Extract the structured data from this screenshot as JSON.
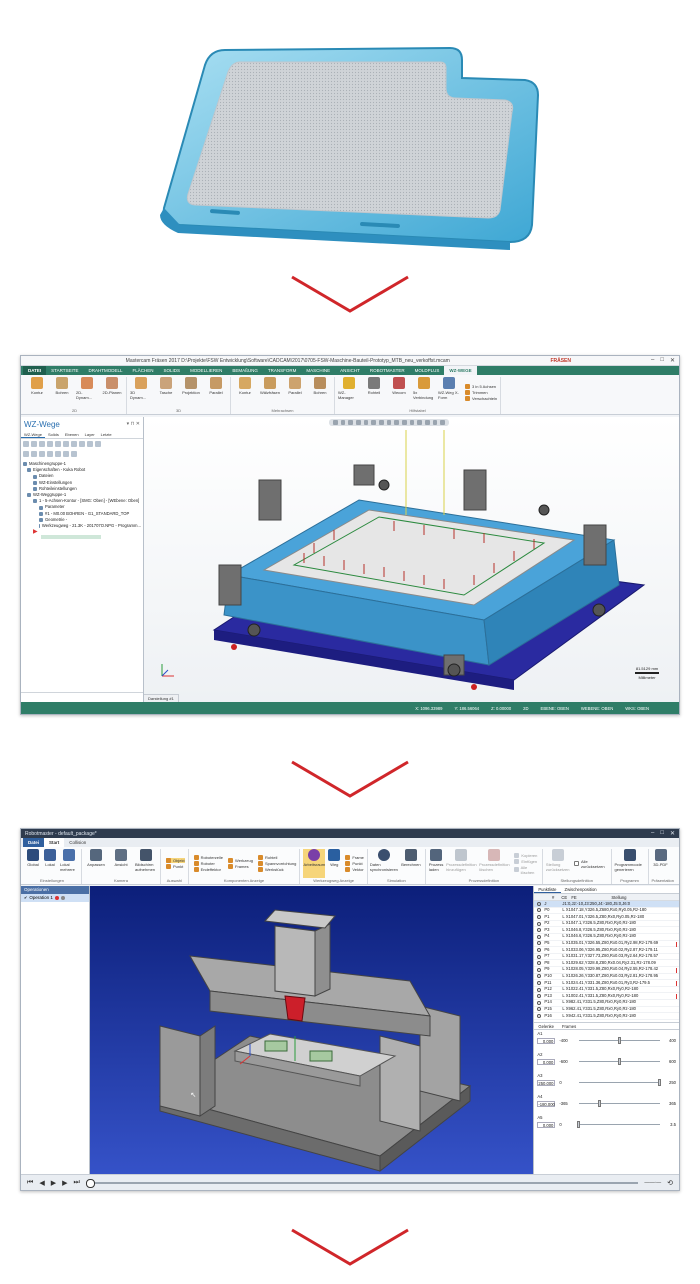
{
  "cam_window": {
    "title": "Mastercam Fräsen 2017  D:\\Projekte\\FSW Entwicklung\\Software\\CADCAM\\2017\\0705-FSW-Maschine-Bauteil-Prototyp_MTB_neu_verkoffst.mcam",
    "context_tab": "FRÄSEN",
    "tabs": [
      "DATEI",
      "STARTSEITE",
      "DRAHTMODELL",
      "FLÄCHEN",
      "SOLIDS",
      "MODELLIEREN",
      "BEMAßUNG",
      "TRANSFORM",
      "MASCHINE",
      "ANSICHT",
      "ROBOTMASTER",
      "MOLDPLUS",
      "WZ-WEGE"
    ],
    "active_tab": "WZ-WEGE",
    "ribbon": {
      "group_2d": {
        "label": "2D",
        "items": [
          "Kontur",
          "Bohren",
          "2D-Dynam...",
          "2D-Planen",
          "3D Dynam...",
          "Tasche",
          "Projektion",
          "Parallel"
        ]
      },
      "group_3d": {
        "label": "3D",
        "items": []
      },
      "group_mehrachsen": {
        "label": "Mehrachsen",
        "items": [
          "Kontur",
          "Wälzfräsen",
          "Parallel",
          "Bohren"
        ]
      },
      "group_hilfstabel": {
        "label": "Hilfstabel",
        "items": [
          "WZ-Manager",
          "Rohteil",
          "Wecom",
          "5x Verbindung",
          "WZ-Weg X-Form",
          "3 in 5 Achsen",
          "Trimmen",
          "Verschachteln"
        ]
      }
    },
    "panel": {
      "title": "WZ-Wege",
      "subtabs": [
        "WZ-Wege",
        "Solids",
        "Ebenen",
        "Layer",
        "Letzte"
      ],
      "tree": [
        "Maschinengruppe-1",
        "Eigenschaften - Kuka Robot",
        "Dateien",
        "WZ-Einstellungen",
        "Rohteileinstellungen",
        "WZ-Weggruppe-1",
        "1 - 5-Achsen-Kontur - [SMG: Oben] - [WEbene: Oben]",
        "Parameter",
        "#1 - M0.00 BOHREN - G1_STANDARD_TOP",
        "Geometrie -",
        "Werkzeugweg - 21.3K - 201707O.NPG - Programm...",
        "",
        ""
      ]
    },
    "view_tab": "Darstellung #1",
    "scale": {
      "value": "81.5129 mm",
      "unit": "Millimeter"
    },
    "status": [
      "X: 1096.33989",
      "Y: 186.56064",
      "Z: 0.00000",
      "2D",
      "EBENE: OBEN",
      "WEBENE: OBEN",
      "WKS: OBEN"
    ]
  },
  "robot_window": {
    "title": "Robotmaster - default_package*",
    "tabs": [
      "Datei",
      "Start",
      "Collision"
    ],
    "active_tab": "Start",
    "ribbon": [
      {
        "label": "Einstellungen",
        "items": [
          "Global",
          "Lokal",
          "Lokal mehrere"
        ]
      },
      {
        "label": "Kamera",
        "items": [
          "Anpassen",
          "Ansicht",
          "Bildschirm aufnehmen"
        ]
      },
      {
        "label": "Auswahl",
        "items": [
          "Objekt",
          "Punkt"
        ]
      },
      {
        "label": "Komponenten Anzeige",
        "items": [
          "Roboterzelle",
          "Roboter",
          "Endeffektor",
          "Werkzeug",
          "Frames",
          "Rohteil",
          "Spannvorrichtung",
          "Werkstück"
        ]
      },
      {
        "label": "Werkzeugweg Anzeige",
        "items": [
          "Arbeitsraum",
          "Weg",
          "Frame",
          "Punkt",
          "Vektor"
        ]
      },
      {
        "label": "Simulation",
        "items": [
          "Daten synchronisieren",
          "Berechnen"
        ]
      },
      {
        "label": "Prozessdefinition",
        "items": [
          "Prozess laden",
          "Prozessdefinition hinzufügen",
          "Prozessdefinition löschen",
          "Kopieren",
          "Einfügen",
          "Alle löschen"
        ]
      },
      {
        "label": "Stellungsdefinition",
        "items": [
          "Stellung zurücksetzen",
          "Alle zurücksetzen"
        ]
      },
      {
        "label": "Programm",
        "items": [
          "Programmcode generieren"
        ]
      },
      {
        "label": "Präsentation",
        "items": [
          "3D-PDF"
        ]
      }
    ],
    "operations": {
      "header": "Operationen",
      "item": "Operation 1"
    },
    "right_tabs": [
      "Punktliste",
      "Zwischenposition"
    ],
    "point_headers": [
      "#",
      "CE",
      "FE",
      "Stellung"
    ],
    "points": [
      {
        "name": "J",
        "value": "J1:0,J2:-10,J3:250,J4:-180,J5:0,J6:0"
      },
      {
        "name": "P0",
        "value": "L X1047.18,Y326.5,Z680,Rx0,Ry0.05,Rz-180"
      },
      {
        "name": "P1",
        "value": "L X1047.01,Y326.5,Z80,Rx0,Ry0.05,Rz-180"
      },
      {
        "name": "P2",
        "value": "L X1047.1,Y326.5,Z80,Rx0,Ry0,Rz-180"
      },
      {
        "name": "P3",
        "value": "L X1046.8,Y326.5,Z80,Rx0,Ry0,Rz-180"
      },
      {
        "name": "P4",
        "value": "L X1046.6,Y326.5,Z80,Rx0,Ry0,Rz-180"
      },
      {
        "name": "P5",
        "value": "L X1035.01,Y326.55,Z80,Rx0.01,Ry2.98,Rz-179.69"
      },
      {
        "name": "P6",
        "value": "L X1033.06,Y326.95,Z80,Rx0.02,Ry2.87,Rz-179.11"
      },
      {
        "name": "P7",
        "value": "L X1031.17,Y327.73,Z80,Rx0.03,Ry2.64,Rz-178.57"
      },
      {
        "name": "P8",
        "value": "L X1029.62,Y328.8,Z80,Rx0.04,Ry2.31,Rz-178.09"
      },
      {
        "name": "P9",
        "value": "L X1028.05,Y329.99,Z80,Rx0.04,Ry2.55,Rz-178.42"
      },
      {
        "name": "P10",
        "value": "L X1026.26,Y330.87,Z80,Rx0.03,Ry2.81,Rz-178.95"
      },
      {
        "name": "P11",
        "value": "L X1024.41,Y331.36,Z80,Rx0.01,Ry3,Rz-179.5"
      },
      {
        "name": "P12",
        "value": "L X1022.41,Y331.5,Z80,Rx0,Ry0,Rz-180"
      },
      {
        "name": "P13",
        "value": "L X1002.41,Y331.5,Z80,Rx0,Ry0,Rz-180"
      },
      {
        "name": "P14",
        "value": "L X982.41,Y331.5,Z80,Rx0,Ry0,Rz-180"
      },
      {
        "name": "P15",
        "value": "L X962.41,Y331.5,Z80,Rx0,Ry0,Rz-180"
      },
      {
        "name": "P16",
        "value": "L X942.41,Y331.5,Z80,Rx0,Ry0,Rz-180"
      }
    ],
    "joint_tabs": [
      "Gelenke",
      "Frames"
    ],
    "joints": [
      {
        "label": "A1",
        "value": "0.000",
        "min": "-400",
        "max": "400",
        "level": 0.5
      },
      {
        "label": "A2",
        "value": "0.000",
        "min": "-600",
        "max": "600",
        "level": 0.5
      },
      {
        "label": "A3",
        "value": "250.000",
        "min": "0",
        "max": "250",
        "level": 1.0
      },
      {
        "label": "A4",
        "value": "-180.000",
        "min": "-365",
        "max": "365",
        "level": 0.25
      },
      {
        "label": "A5",
        "value": "0.000",
        "min": "0",
        "max": "3.5",
        "level": 0.0
      }
    ]
  },
  "colors": {
    "cam_accent": "#2f7d67",
    "robot_accent": "#2f5f9e",
    "arrow": "#d0262a",
    "part_blue": "#5fbde0",
    "fixture_blue": "#4aa3d9"
  }
}
